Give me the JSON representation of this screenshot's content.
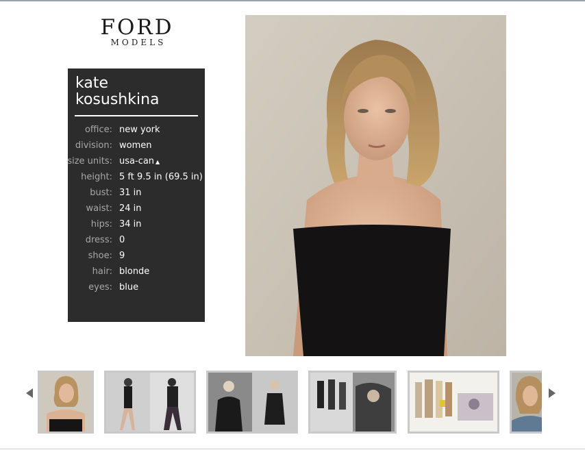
{
  "brand": {
    "name_line1": "FORD",
    "name_line2": "MODELS"
  },
  "model": {
    "name_line1": "kate",
    "name_line2": "kosushkina",
    "stats": [
      {
        "label": "office:",
        "value": "new york"
      },
      {
        "label": "division:",
        "value": "women"
      },
      {
        "label": "size units:",
        "value": "usa-can"
      },
      {
        "label": "height:",
        "value": "5 ft 9.5 in (69.5 in)"
      },
      {
        "label": "bust:",
        "value": "31 in"
      },
      {
        "label": "waist:",
        "value": "24 in"
      },
      {
        "label": "hips:",
        "value": "34 in"
      },
      {
        "label": "dress:",
        "value": "0"
      },
      {
        "label": "shoe:",
        "value": "9"
      },
      {
        "label": "hair:",
        "value": "blonde"
      },
      {
        "label": "eyes:",
        "value": "blue"
      }
    ]
  },
  "icons": {
    "prev": "arrow-left-icon",
    "next": "arrow-right-icon",
    "size_toggle": "caret-up-icon"
  },
  "colors": {
    "panel_bg": "#2c2c2c",
    "label": "#a8a8a8",
    "value": "#ffffff",
    "thumb_border": "#c9c9c9"
  }
}
